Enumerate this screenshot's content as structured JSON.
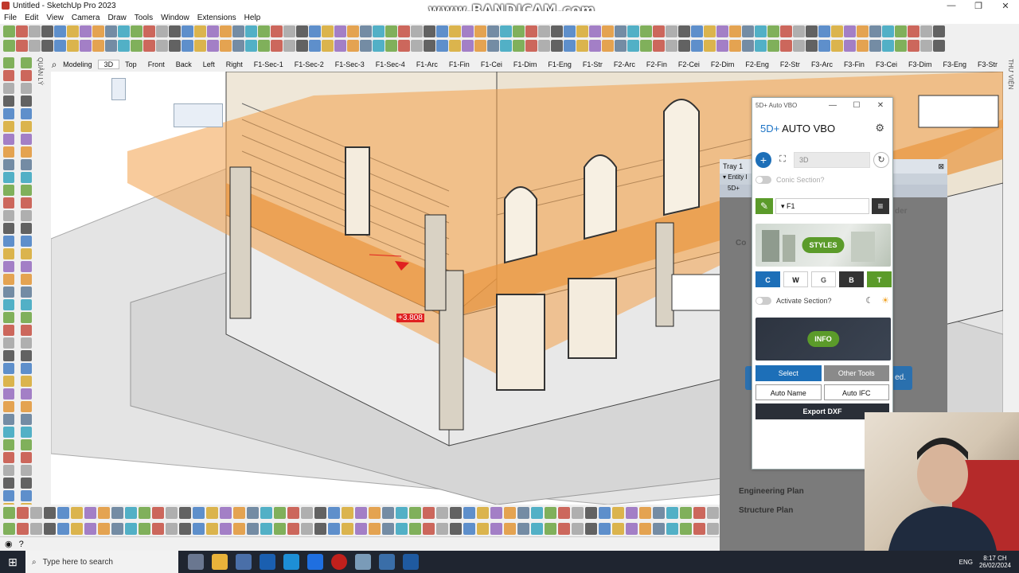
{
  "window": {
    "title": "Untitled - SketchUp Pro 2023",
    "watermark": "www.BANDICAM.com",
    "min": "—",
    "max": "❐",
    "close": "✕"
  },
  "menu": [
    "File",
    "Edit",
    "View",
    "Camera",
    "Draw",
    "Tools",
    "Window",
    "Extensions",
    "Help"
  ],
  "scene_tabs": [
    "Modeling",
    "3D",
    "Top",
    "Front",
    "Back",
    "Left",
    "Right",
    "F1-Sec-1",
    "F1-Sec-2",
    "F1-Sec-3",
    "F1-Sec-4",
    "F1-Arc",
    "F1-Fin",
    "F1-Cei",
    "F1-Dim",
    "F1-Eng",
    "F1-Str",
    "F2-Arc",
    "F2-Fin",
    "F2-Cei",
    "F2-Dim",
    "F2-Eng",
    "F2-Str",
    "F3-Arc",
    "F3-Fin",
    "F3-Cei",
    "F3-Dim",
    "F3-Eng",
    "F3-Str"
  ],
  "active_scene": "3D",
  "left_label": "QUẢN LÝ",
  "right_label": "THƯ VIỆN",
  "viewport": {
    "measurement": "+3.808"
  },
  "tray": {
    "title": "Tray 1",
    "entity": "Entity I",
    "plugin_tab": "5D+",
    "ghost_labels": [
      "Engineering Plan",
      "Structure Plan"
    ],
    "ghost_button_text": "ed.",
    "ghost_cut": "der",
    "ghost_side": "Co"
  },
  "plugin": {
    "window_title": "5D+ Auto VBO",
    "brand_prefix": "5D+",
    "brand_name": "AUTO VBO",
    "view_input": "3D",
    "conic_section": "Conic Section?",
    "floor_select": "F1",
    "styles_label": "STYLES",
    "style_buttons": [
      "C",
      "W",
      "G",
      "B",
      "T"
    ],
    "activate_section": "Activate Section?",
    "info_label": "INFO",
    "select_btn": "Select",
    "other_tools_btn": "Other Tools",
    "auto_name_btn": "Auto Name",
    "auto_ifc_btn": "Auto IFC",
    "export_dxf_btn": "Export DXF"
  },
  "taskbar": {
    "search_placeholder": "Type here to search",
    "language": "ENG",
    "time": "8:17 CH",
    "date": "26/02/2024"
  },
  "colors": {
    "orange_plane": "#f2a04a",
    "accent_blue": "#1d6fb8",
    "accent_green": "#5b9b2a"
  }
}
